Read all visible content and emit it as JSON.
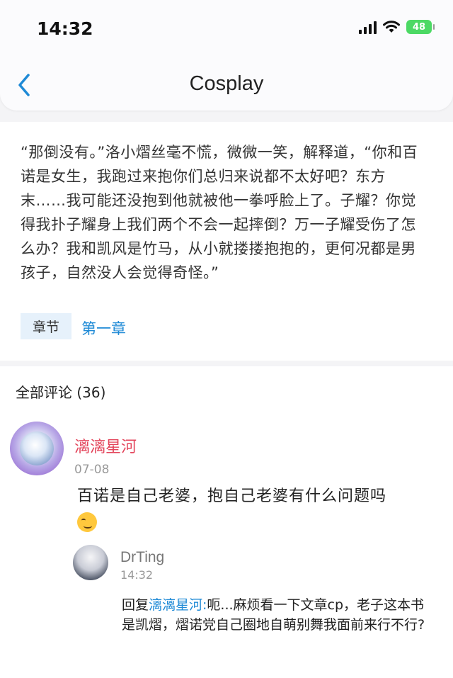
{
  "status_bar": {
    "time": "14:32",
    "battery": "48"
  },
  "nav": {
    "title": "Cosplay"
  },
  "article": {
    "text": "“那倒没有。”洛小熠丝毫不慌，微微一笑，解释道，“你和百诺是女生，我跑过来抱你们总归来说都不太好吧？东方末……我可能还没抱到他就被他一拳呼脸上了。子耀？你觉得我扑子耀身上我们两个不会一起摔倒？万一子耀受伤了怎么办？我和凯风是竹马，从小就搂搂抱抱的，更何况都是男孩子，自然没人会觉得奇怪。”",
    "tag_label": "章节",
    "chapter_link": "第一章"
  },
  "comments": {
    "header": "全部评论 (36)",
    "items": [
      {
        "user": "漓漓星河",
        "date": "07-08",
        "text": "百诺是自己老婆，抱自己老婆有什么问题吗",
        "replies": [
          {
            "user": "DrTing",
            "time": "14:32",
            "prefix": "回复",
            "reply_to": "漓漓星河:",
            "text": "呃...麻烦看一下文章cp，老子这本书是凯熠，熠诺党自己圈地自萌别舞我面前来行不行?"
          }
        ]
      }
    ]
  },
  "colors": {
    "accent": "#1f8ad6",
    "username_pink": "#e3455b",
    "tag_bg": "#e6f1fb"
  }
}
